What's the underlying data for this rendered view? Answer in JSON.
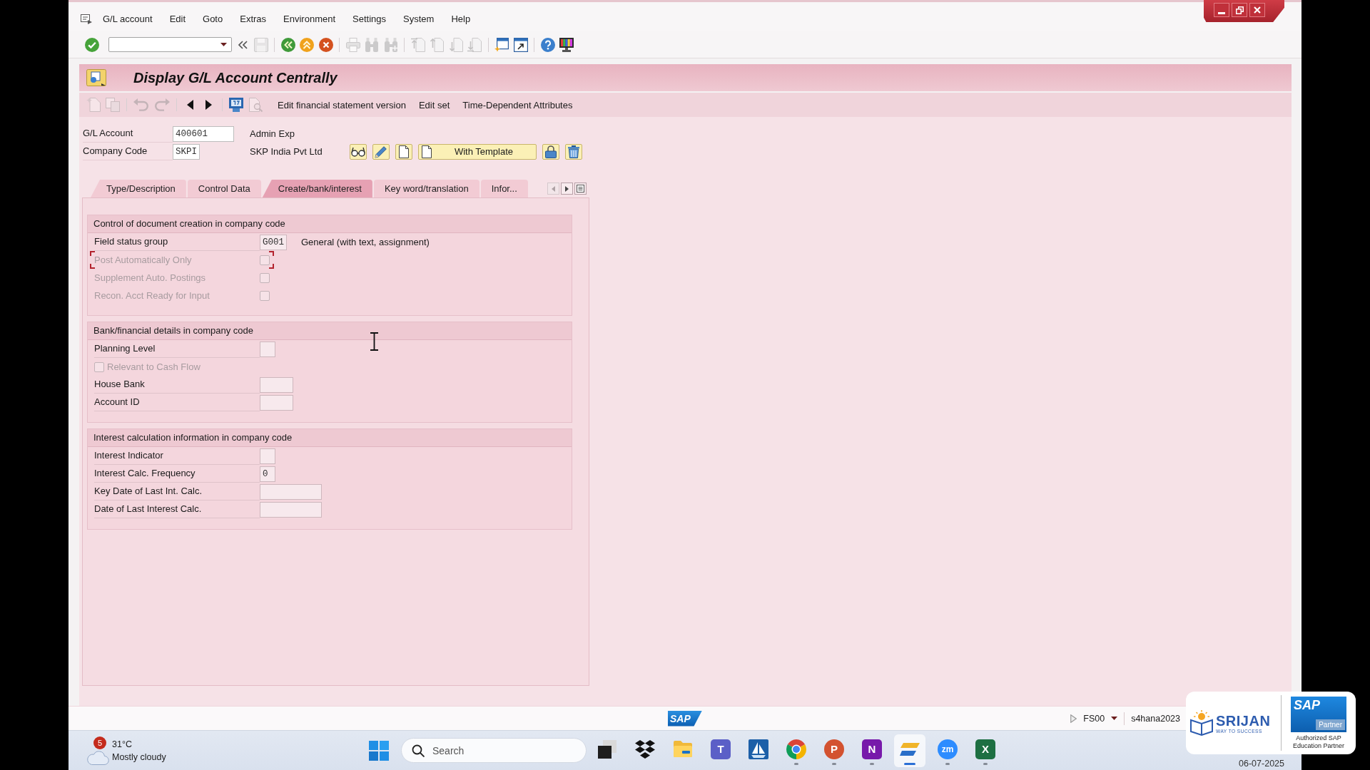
{
  "window": {
    "controls": [
      {
        "kind": "minimize"
      },
      {
        "kind": "restore"
      },
      {
        "kind": "close"
      }
    ]
  },
  "menu_bar": {
    "items": [
      "G/L account",
      "Edit",
      "Goto",
      "Extras",
      "Environment",
      "Settings",
      "System",
      "Help"
    ]
  },
  "toolbar": {
    "groups": [
      [
        {
          "kind": "enter",
          "disabled": false
        },
        {
          "kind": "command_field",
          "disabled": false
        },
        {
          "kind": "collapse",
          "disabled": false
        },
        {
          "kind": "save",
          "disabled": true
        }
      ],
      [
        {
          "kind": "back",
          "disabled": false
        },
        {
          "kind": "exit",
          "disabled": false
        },
        {
          "kind": "cancel",
          "disabled": false
        }
      ],
      [
        {
          "kind": "print",
          "disabled": true
        },
        {
          "kind": "find",
          "disabled": true
        },
        {
          "kind": "find_next",
          "disabled": true
        }
      ],
      [
        {
          "kind": "first_page",
          "disabled": true
        },
        {
          "kind": "previous_page",
          "disabled": true
        },
        {
          "kind": "next_page",
          "disabled": true
        },
        {
          "kind": "last_page",
          "disabled": true
        }
      ],
      [
        {
          "kind": "new_session",
          "disabled": false
        },
        {
          "kind": "shortcut",
          "disabled": false
        }
      ],
      [
        {
          "kind": "help",
          "disabled": false
        },
        {
          "kind": "layout",
          "disabled": false
        }
      ]
    ]
  },
  "title_bar": {
    "title": "Display G/L Account Centrally"
  },
  "app_toolbar": {
    "icon_groups": [
      [
        {
          "kind": "create",
          "disabled": true
        },
        {
          "kind": "copy",
          "disabled": true
        }
      ],
      [
        {
          "kind": "undo",
          "disabled": true
        },
        {
          "kind": "redo",
          "disabled": true
        }
      ],
      [
        {
          "kind": "previous",
          "disabled": false
        },
        {
          "kind": "next",
          "disabled": false
        }
      ],
      [
        {
          "kind": "calendar",
          "disabled": false
        },
        {
          "kind": "document_search",
          "disabled": true
        }
      ]
    ],
    "buttons": [
      "Edit financial statement version",
      "Edit set",
      "Time-Dependent Attributes"
    ]
  },
  "header": {
    "fields": [
      {
        "label": "G/L Account",
        "kind": "field_l",
        "value": "400601",
        "description": "Admin Exp"
      },
      {
        "label": "Company Code",
        "kind": "field_s",
        "value": "SKPI",
        "description": "SKP India Pvt Ltd"
      }
    ],
    "actions": [
      {
        "kind": "display"
      },
      {
        "kind": "change"
      },
      {
        "kind": "create"
      },
      {
        "kind": "create_with_template",
        "label": "With Template"
      },
      {
        "kind": "block"
      },
      {
        "kind": "delete"
      }
    ]
  },
  "tabs": {
    "items": [
      {
        "label": "Type/Description",
        "selected": false
      },
      {
        "label": "Control Data",
        "selected": false
      },
      {
        "label": "Create/bank/interest",
        "selected": true
      },
      {
        "label": "Key word/translation",
        "selected": false
      },
      {
        "label": "Infor...",
        "selected": false
      }
    ],
    "scroll": [
      {
        "kind": "left",
        "disabled": true
      },
      {
        "kind": "right",
        "disabled": false
      },
      {
        "kind": "list",
        "disabled": false
      }
    ]
  },
  "groups": [
    {
      "title": "Control of document creation in company code",
      "rows": [
        {
          "kind": "field_s",
          "label": "Field status group",
          "value": "G001",
          "description": "General (with text, assignment)",
          "disabled": false,
          "focused": false
        },
        {
          "kind": "checkbox",
          "label": "Post Automatically Only",
          "checked": false,
          "disabled": true,
          "focused": true
        },
        {
          "kind": "checkbox",
          "label": "Supplement Auto. Postings",
          "checked": false,
          "disabled": true,
          "focused": false
        },
        {
          "kind": "checkbox",
          "label": "Recon. Acct Ready for Input",
          "checked": false,
          "disabled": true,
          "focused": false
        }
      ]
    },
    {
      "title": "Bank/financial details in company code",
      "rows": [
        {
          "kind": "field_xs",
          "label": "Planning Level",
          "disabled": false,
          "focused": false
        },
        {
          "kind": "checkbox_left",
          "label": "Relevant to Cash Flow",
          "checked": false,
          "disabled": true,
          "focused": false
        },
        {
          "kind": "field_m",
          "label": "House Bank",
          "disabled": false,
          "focused": false
        },
        {
          "kind": "field_m",
          "label": "Account ID",
          "disabled": false,
          "focused": false
        }
      ]
    },
    {
      "title": "Interest calculation information in company code",
      "rows": [
        {
          "kind": "field_xs",
          "label": "Interest Indicator",
          "disabled": false,
          "focused": false
        },
        {
          "kind": "field_xs",
          "label": "Interest Calc. Frequency",
          "value": "0",
          "disabled": false,
          "focused": false
        },
        {
          "kind": "field_date",
          "label": "Key Date of Last Int. Calc.",
          "disabled": false,
          "focused": false
        },
        {
          "kind": "field_date",
          "label": "Date of Last Interest Calc.",
          "disabled": false,
          "focused": false
        }
      ]
    }
  ],
  "status_bar": {
    "logo": "SAP",
    "transaction": "FS00",
    "system": "s4hana2023"
  },
  "taskbar": {
    "weather": {
      "badge": "5",
      "temperature": "31°C",
      "condition": "Mostly cloudy"
    },
    "search": {
      "placeholder": "Search"
    },
    "apps": [
      {
        "kind": "squares",
        "running": false,
        "active": false
      },
      {
        "kind": "diamonds",
        "running": false,
        "active": false
      },
      {
        "kind": "folder",
        "running": false,
        "active": false
      },
      {
        "kind": "letter_tile",
        "glyph": "T",
        "color": "#5b5fc7",
        "running": false,
        "active": false
      },
      {
        "kind": "sailboat",
        "running": false,
        "active": false
      },
      {
        "kind": "tricolor_circle",
        "running": true,
        "active": false
      },
      {
        "kind": "letter_circle",
        "glyph": "P",
        "color": "#d35230",
        "running": true,
        "active": false
      },
      {
        "kind": "letter_tile",
        "glyph": "N",
        "color": "#7719aa",
        "running": true,
        "active": false
      },
      {
        "kind": "stripes",
        "running": true,
        "active": true
      },
      {
        "kind": "letter_circle",
        "glyph": "zm",
        "color": "#2d8cff",
        "running": true,
        "active": false
      },
      {
        "kind": "letter_tile",
        "glyph": "X",
        "color": "#1d6f42",
        "running": true,
        "active": false
      }
    ],
    "date": "06-07-2025"
  },
  "partner_logo": {
    "brand": "SRIJAN",
    "tagline": "WAY TO SUCCESS",
    "badge": "SAP",
    "badge_caption": "Partner",
    "caption": "Authorized SAP Education Partner"
  }
}
